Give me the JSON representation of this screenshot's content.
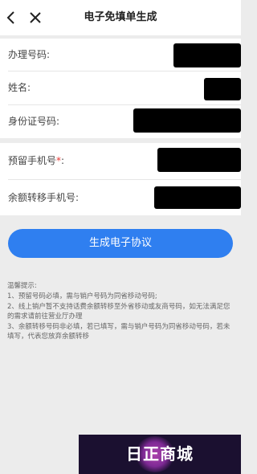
{
  "header": {
    "title": "电子免填单生成",
    "back_icon": "chevron-left-icon",
    "close_icon": "close-icon"
  },
  "form": {
    "fields": [
      {
        "label": "办理号码:",
        "required": false
      },
      {
        "label": "姓名:",
        "required": false
      },
      {
        "label": "身份证号码:",
        "required": false
      },
      {
        "label": "预留手机号",
        "required": true,
        "required_mark": "*",
        "suffix": ":"
      },
      {
        "label": "余额转移手机号:",
        "required": false
      }
    ],
    "value_state": "redacted"
  },
  "submit_button": {
    "label": "生成电子协议",
    "color": "#2f7ff0"
  },
  "tips": {
    "title": "温馨提示:",
    "items": [
      "1、预留号码必填，需与销户号码为同省移动号码;",
      "2、线上销户暂不支持话费余额转移至外省移动或友商号码，如无法满足您的需求请前往营业厅办理",
      "3、余额转移号码非必填，若已填写，需与销户号码为同省移动号码，若未填写，代表您放弃余额转移"
    ]
  },
  "watermark": {
    "text": "日正商城"
  }
}
